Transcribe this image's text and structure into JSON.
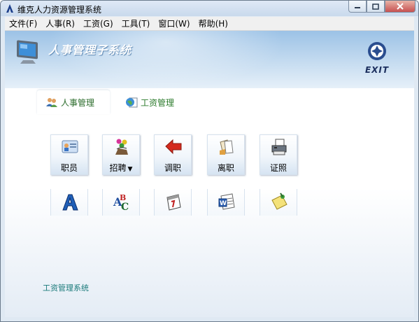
{
  "window": {
    "title": "维克人力资源管理系统"
  },
  "menubar": {
    "items": [
      "文件(F)",
      "人事(R)",
      "工资(G)",
      "工具(T)",
      "窗口(W)",
      "帮助(H)"
    ]
  },
  "banner": {
    "title": "人事管理子系统",
    "exit_label": "EXIT"
  },
  "tabs": [
    {
      "label": "人事管理",
      "icon": "people-icon",
      "active": true
    },
    {
      "label": "工资管理",
      "icon": "globe-document-icon",
      "active": false
    }
  ],
  "tiles_row1": [
    {
      "label": "职员",
      "icon": "id-card-icon"
    },
    {
      "label": "招聘",
      "icon": "recruit-balls-icon",
      "dropdown": true,
      "arrow": "▼"
    },
    {
      "label": "调职",
      "icon": "red-arrow-icon"
    },
    {
      "label": "离职",
      "icon": "documents-icon"
    },
    {
      "label": "证照",
      "icon": "printer-icon"
    }
  ],
  "tiles_row2": [
    {
      "icon": "font-a-icon"
    },
    {
      "icon": "abc-icon"
    },
    {
      "icon": "calendar-icon"
    },
    {
      "icon": "word-document-icon"
    },
    {
      "icon": "sticky-note-icon"
    }
  ],
  "footer": {
    "link": "工资管理系统"
  },
  "colors": {
    "banner": "#9cc2e6",
    "tab_text": "#2a7a2a",
    "footer_link": "#1a7a7a",
    "title_bar": "#c9d9ec"
  }
}
